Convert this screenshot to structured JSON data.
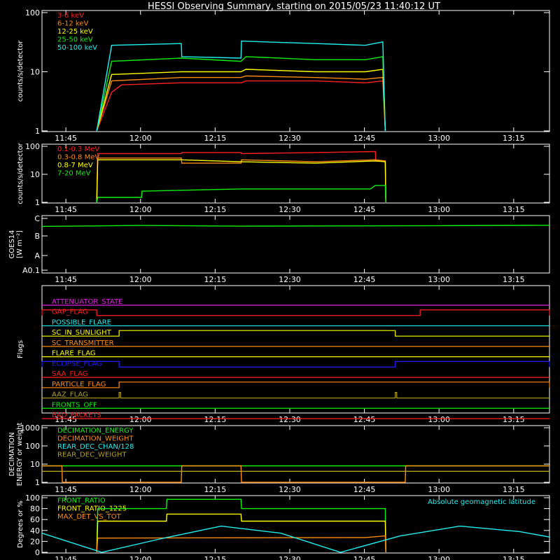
{
  "title": "HESSI Observing Summary, starting on 2015/05/23 11:40:12 UT",
  "time_ticks": [
    "11:45",
    "12:00",
    "12:15",
    "12:30",
    "12:45",
    "13:00",
    "13:15"
  ],
  "colors": {
    "red": "#ff2020",
    "orange": "#ff8c10",
    "yellow": "#ffff00",
    "green": "#10f010",
    "cyan": "#20f0f0",
    "magenta": "#e020e0",
    "blue": "#2020ff",
    "olive": "#b0a020",
    "white": "#ffffff"
  },
  "chart_data": [
    {
      "type": "line",
      "panel": "count rates low energy",
      "ylabel": "counts/s/detector",
      "yscale": "log",
      "ylim": [
        1,
        100
      ],
      "yticks": [
        "100",
        "10",
        "1"
      ],
      "x_unit": "minutes since 11:40:12 UT",
      "xlim": [
        0,
        102
      ],
      "legend": [
        "3-6 keV",
        "6-12 keV",
        "12-25 keV",
        "25-50 keV",
        "50-100 keV"
      ],
      "series": [
        {
          "name": "3-6 keV",
          "color": "red",
          "x": [
            11,
            14,
            16,
            28,
            40,
            41,
            55,
            65,
            68.5,
            69
          ],
          "y": [
            1,
            4.5,
            6,
            6.5,
            6.5,
            7,
            7,
            6.5,
            7,
            1
          ]
        },
        {
          "name": "6-12 keV",
          "color": "orange",
          "x": [
            11,
            14,
            28,
            40,
            41,
            55,
            65,
            68.5,
            69
          ],
          "y": [
            1,
            7,
            8,
            8,
            8.5,
            8,
            7.5,
            8,
            1
          ]
        },
        {
          "name": "12-25 keV",
          "color": "yellow",
          "x": [
            11,
            14,
            28,
            40,
            41,
            55,
            65,
            68.5,
            69
          ],
          "y": [
            1,
            9,
            10,
            10,
            11,
            10,
            10,
            11,
            1
          ]
        },
        {
          "name": "25-50 keV",
          "color": "green",
          "x": [
            11,
            14,
            28,
            40,
            41,
            55,
            65,
            68.5,
            69
          ],
          "y": [
            1,
            15,
            17,
            15,
            18,
            16,
            16,
            18,
            1
          ]
        },
        {
          "name": "50-100 keV",
          "color": "cyan",
          "x": [
            11,
            14,
            28,
            28.1,
            40,
            40.1,
            55,
            65,
            68.5,
            69
          ],
          "y": [
            1,
            28,
            30,
            18,
            17,
            33,
            30,
            28,
            32,
            1
          ]
        }
      ]
    },
    {
      "type": "line",
      "panel": "count rates high energy",
      "ylabel": "counts/s/detector",
      "yscale": "log",
      "ylim": [
        1,
        100
      ],
      "yticks": [
        "100",
        "10",
        "1"
      ],
      "x_unit": "minutes since 11:40:12 UT",
      "xlim": [
        0,
        102
      ],
      "legend": [
        "0.1-0.3 MeV",
        "0.3-0.8 MeV",
        "0.8-7 MeV",
        "7-20 MeV"
      ],
      "series": [
        {
          "name": "0.1-0.3 MeV",
          "color": "red",
          "x": [
            11,
            11.2,
            28,
            28.1,
            40,
            40.1,
            55,
            67,
            67.1,
            69,
            69.1
          ],
          "y": [
            1,
            55,
            55,
            60,
            60,
            55,
            60,
            65,
            30,
            30,
            1
          ]
        },
        {
          "name": "0.3-0.8 MeV",
          "color": "orange",
          "x": [
            11,
            11.2,
            28,
            28.1,
            40,
            40.1,
            55,
            67,
            69,
            69.1
          ],
          "y": [
            1,
            38,
            38,
            25,
            25,
            33,
            28,
            33,
            30,
            1
          ]
        },
        {
          "name": "0.8-7 MeV",
          "color": "yellow",
          "x": [
            11,
            11.2,
            28,
            40,
            55,
            67,
            69,
            69.1
          ],
          "y": [
            1,
            33,
            33,
            28,
            25,
            30,
            28,
            1
          ]
        },
        {
          "name": "7-20 MeV",
          "color": "green",
          "x": [
            11,
            11.2,
            20,
            20.1,
            40,
            55,
            66,
            67,
            69,
            69.1
          ],
          "y": [
            1,
            1.5,
            1.5,
            2.5,
            3,
            3,
            3,
            4,
            4,
            1
          ]
        }
      ]
    },
    {
      "type": "line",
      "panel": "GOES",
      "ylabel": "GOES14 [W m-2]",
      "ylabel_lines": [
        "GOES14",
        "[W m⁻²]"
      ],
      "yticks": [
        "C",
        "B",
        "A",
        "A0.1"
      ],
      "yscale": "log",
      "ylim": [
        0.1,
        10
      ],
      "x_unit": "minutes since 11:40:12 UT",
      "xlim": [
        0,
        102
      ],
      "series": [
        {
          "name": "GOES14",
          "color": "green",
          "x": [
            0,
            20,
            40,
            60,
            80,
            102
          ],
          "y": [
            4.8,
            5.2,
            4.9,
            5.0,
            5.1,
            5.3
          ]
        }
      ]
    },
    {
      "type": "line",
      "panel": "Flags",
      "ylabel": "Flags",
      "x_unit": "minutes since 11:40:12 UT",
      "xlim": [
        0,
        102
      ],
      "flags": [
        {
          "name": "ATTENUATOR_STATE",
          "color": "magenta",
          "on": []
        },
        {
          "name": "GAP_FLAG",
          "color": "red",
          "on": [
            [
              0,
              11
            ],
            [
              76,
              102
            ]
          ]
        },
        {
          "name": "POSSIBLE_FLARE",
          "color": "cyan",
          "on": []
        },
        {
          "name": "SC_IN_SUNLIGHT",
          "color": "yellow",
          "on": [
            [
              15.5,
              71
            ]
          ]
        },
        {
          "name": "SC_TRANSMITTER",
          "color": "orange",
          "on": []
        },
        {
          "name": "FLARE_FLAG",
          "color": "yellow",
          "on": []
        },
        {
          "name": "ECLIPSE_FLAG",
          "color": "blue",
          "on": [
            [
              0,
              15.5
            ],
            [
              71,
              102
            ]
          ]
        },
        {
          "name": "SAA_FLAG",
          "color": "red",
          "on": []
        },
        {
          "name": "PARTICLE_FLAG",
          "color": "orange",
          "on": [
            [
              15.5,
              102
            ]
          ]
        },
        {
          "name": "AAZ_FLAG",
          "color": "olive",
          "on": [
            [
              15.5,
              15.8
            ],
            [
              71,
              71.3
            ]
          ]
        },
        {
          "name": "FRONTS_OFF",
          "color": "green",
          "on": []
        },
        {
          "name": "BAD_PACKETS",
          "color": "red",
          "on": []
        }
      ]
    },
    {
      "type": "line",
      "panel": "Decimation",
      "ylabel": "DECIMATION ENERGY or weight",
      "ylabel_lines": [
        "DECIMATION",
        "ENERGY or weight"
      ],
      "yscale": "log",
      "ylim": [
        1,
        1000
      ],
      "yticks": [
        "1000",
        "100",
        "10",
        "1"
      ],
      "x_unit": "minutes since 11:40:12 UT",
      "xlim": [
        0,
        102
      ],
      "legend": [
        "DECIMATION_ENERGY",
        "DECIMATION_WEIGHT",
        "REAR_DEC_CHAN/128",
        "REAR_DEC_WEIGHT"
      ],
      "series": [
        {
          "name": "DECIMATION_ENERGY",
          "color": "green",
          "x": [
            0,
            102
          ],
          "y": [
            8,
            8
          ]
        },
        {
          "name": "DECIMATION_WEIGHT",
          "color": "orange",
          "x": [
            0,
            4,
            4.1,
            28,
            28.1,
            40,
            40.1,
            73,
            73.1,
            102
          ],
          "y": [
            8,
            8,
            1,
            1,
            8,
            8,
            1,
            1,
            8,
            8
          ]
        },
        {
          "name": "REAR_DEC_CHAN/128",
          "color": "cyan",
          "x": [],
          "y": []
        },
        {
          "name": "REAR_DEC_WEIGHT",
          "color": "olive",
          "x": [
            0,
            102
          ],
          "y": [
            4,
            4
          ]
        }
      ]
    },
    {
      "type": "line",
      "panel": "Ratios",
      "ylabel": "Degrees or %",
      "ylim": [
        0,
        100
      ],
      "yticks": [
        "100",
        "80",
        "60",
        "40",
        "20",
        "0"
      ],
      "x_unit": "minutes since 11:40:12 UT",
      "xlim": [
        0,
        102
      ],
      "legend": [
        "FRONT_RATIO",
        "FRONT_RATIO_1225",
        "MAX_DET_VS_TOT"
      ],
      "annotation": "Absolute geomagnetic latitude",
      "series": [
        {
          "name": "FRONT_RATIO",
          "color": "green",
          "x": [
            11,
            11.2,
            25,
            25.1,
            40,
            40.1,
            65,
            69,
            69.1
          ],
          "y": [
            0,
            80,
            80,
            97,
            97,
            80,
            80,
            80,
            0
          ]
        },
        {
          "name": "FRONT_RATIO_1225",
          "color": "yellow",
          "x": [
            11,
            11.2,
            25,
            25.1,
            40,
            40.1,
            65,
            69,
            69.1
          ],
          "y": [
            0,
            57,
            57,
            70,
            70,
            57,
            57,
            57,
            0
          ]
        },
        {
          "name": "MAX_DET_VS_TOT",
          "color": "orange",
          "x": [
            11,
            11.2,
            65,
            69,
            69.1
          ],
          "y": [
            0,
            26,
            27,
            30,
            0
          ]
        },
        {
          "name": "Absolute geomagnetic latitude",
          "color": "cyan",
          "x": [
            0,
            12,
            24,
            36,
            48,
            60,
            72,
            84,
            96,
            102
          ],
          "y": [
            35,
            0,
            25,
            48,
            35,
            0,
            30,
            48,
            38,
            28
          ]
        }
      ]
    }
  ]
}
